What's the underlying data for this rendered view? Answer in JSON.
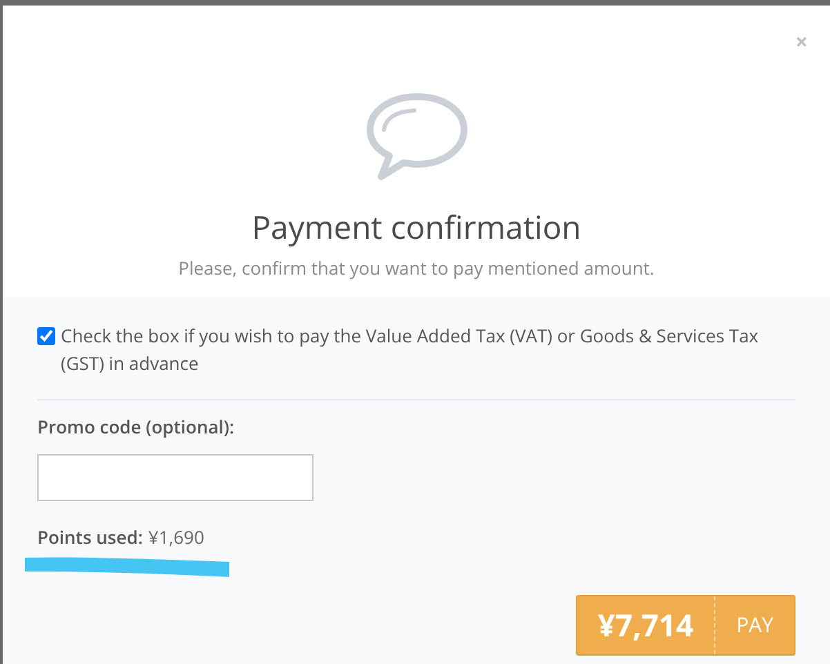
{
  "dialog": {
    "close": "×",
    "title": "Payment confirmation",
    "subtitle": "Please, confirm that you want to pay mentioned amount."
  },
  "tax_option": {
    "label": "Check the box if you wish to pay the Value Added Tax (VAT) or Goods & Services Tax (GST) in advance",
    "checked": true
  },
  "promo": {
    "label": "Promo code (optional):"
  },
  "points": {
    "label": "Points used:",
    "value": "¥1,690"
  },
  "pay_button": {
    "amount": "¥7,714",
    "label": "PAY"
  }
}
